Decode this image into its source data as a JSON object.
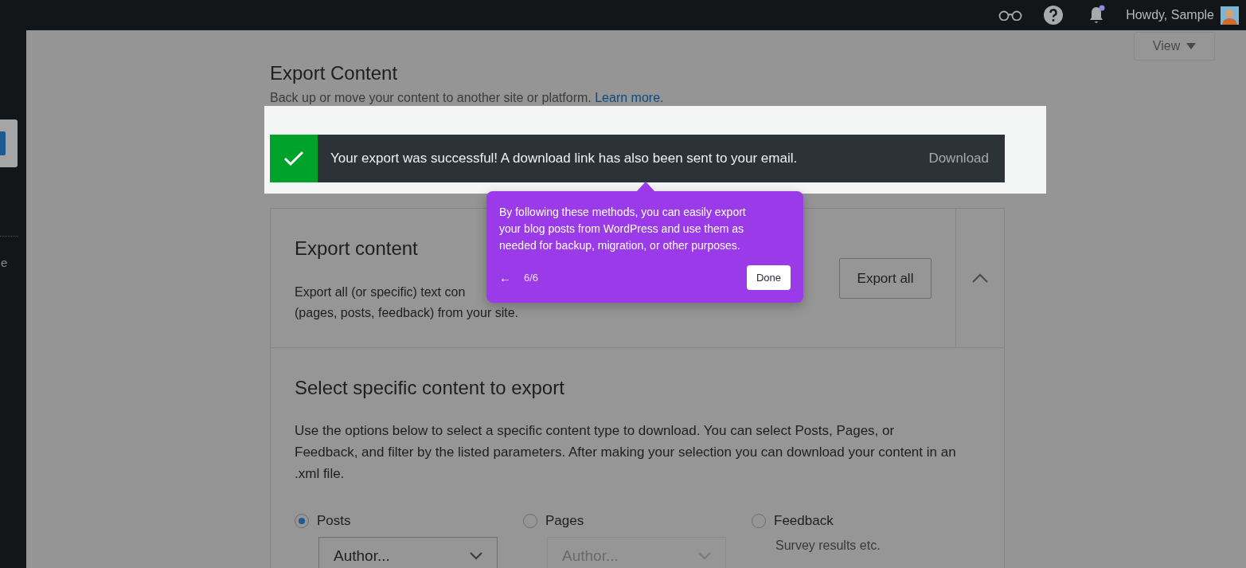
{
  "top_bar": {
    "greeting": "Howdy, Sample",
    "notification_unread": true
  },
  "sidebar": {
    "items": [
      {
        "label": "e"
      }
    ]
  },
  "view_button": {
    "label": "View"
  },
  "header": {
    "title": "Export Content",
    "subtitle": "Back up or move your content to another site or platform.",
    "link": "Learn more."
  },
  "notice": {
    "message": "Your export was successful! A download link has also been sent to your email.",
    "action": "Download"
  },
  "tooltip": {
    "text": "By following these methods, you can easily export your blog posts from WordPress and use them as needed for backup, migration, or other purposes.",
    "back": "←",
    "step": "6/6",
    "done": "Done"
  },
  "export_card": {
    "title": "Export content",
    "description_lines": [
      "Export all (or specific) text con",
      "(pages, posts, feedback) from your site."
    ],
    "button": "Export all",
    "expanded": true
  },
  "specific": {
    "title": "Select specific content to export",
    "description": "Use the options below to select a specific content type to download. You can select Posts, Pages, or Feedback, and filter by the listed parameters. After making your selection you can download your content in an .xml file.",
    "options": [
      {
        "label": "Posts",
        "selected": true,
        "kind": "select",
        "select": "Author...",
        "disabled": false
      },
      {
        "label": "Pages",
        "selected": false,
        "kind": "select",
        "select": "Author...",
        "disabled": true
      },
      {
        "label": "Feedback",
        "selected": false,
        "kind": "note",
        "note": "Survey results etc."
      }
    ]
  }
}
